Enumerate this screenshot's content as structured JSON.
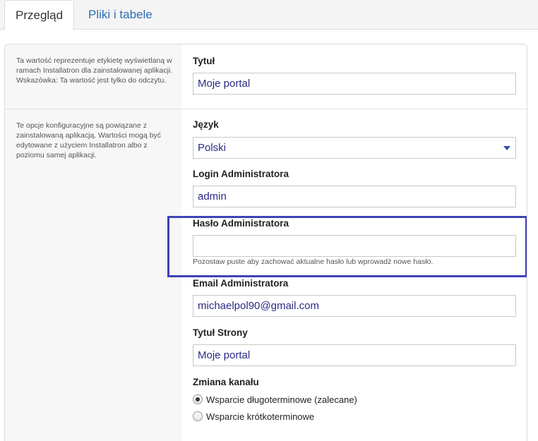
{
  "tabs": [
    {
      "label": "Przegląd",
      "active": true
    },
    {
      "label": "Pliki i tabele",
      "active": false
    }
  ],
  "sections": {
    "title_desc": "Ta wartość reprezentuje etykietę wyświetlaną w ramach Installatron dla zainstalowanej aplikacji. Wskazówka: Ta wartość jest tylko do odczytu.",
    "config_desc": "Te opcje konfiguracyjne są powiązane z zainstalowaną aplikacją. Wartości mogą być edytowane z użyciem Installatron albo z poziomu samej aplikacji."
  },
  "fields": {
    "title": {
      "label": "Tytuł",
      "value": "Moje portal"
    },
    "language": {
      "label": "Język",
      "value": "Polski",
      "icon": "chevron-down-icon"
    },
    "admin_login": {
      "label": "Login Administratora",
      "value": "admin"
    },
    "admin_password": {
      "label": "Hasło Administratora",
      "value": "",
      "hint": "Pozostaw puste aby zachować aktualne hasło lub wprowadź nowe hasło."
    },
    "admin_email": {
      "label": "Email Administratora",
      "value": "michaelpol90@gmail.com"
    },
    "site_title": {
      "label": "Tytuł Strony",
      "value": "Moje portal"
    },
    "channel": {
      "label": "Zmiana kanału",
      "options": [
        {
          "label": "Wsparcie długoterminowe (zalecane)",
          "checked": true
        },
        {
          "label": "Wsparcie krótkoterminowe",
          "checked": false
        }
      ]
    }
  },
  "colors": {
    "highlight_border": "#3f42b7",
    "link": "#2e6db4",
    "input_text": "#2c2a86"
  }
}
